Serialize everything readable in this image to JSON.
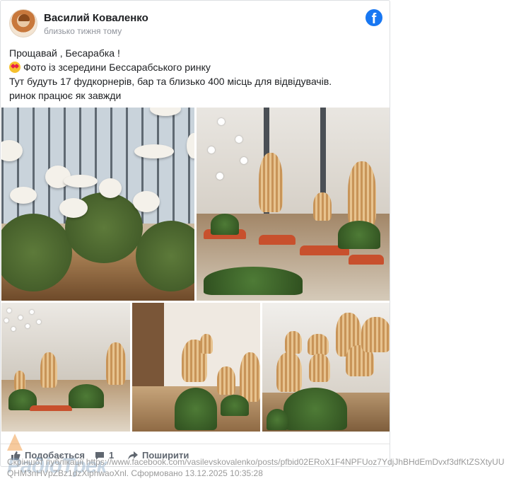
{
  "post": {
    "author": "Василий Коваленко",
    "time": "близько тижня тому",
    "text_lines": [
      "Прощавай , Бесарабка !",
      "Фото із зсередини Бессарабського ринку",
      "Тут будуть 17 фудкорнерів, бар та близько 400 місць для відвідувачів.",
      "ринок працює як завжди"
    ],
    "emoji_icon": "star-struck-emoji-icon",
    "platform_icon": "facebook-icon",
    "platform_logo_letter": "f"
  },
  "photos": [
    {
      "name": "photo-glass-roof-hall"
    },
    {
      "name": "photo-hall-with-lamps-and-sofas"
    },
    {
      "name": "photo-hall-with-bulb-chandelier"
    },
    {
      "name": "photo-food-corner-stalls"
    },
    {
      "name": "photo-wicker-pendant-lamps"
    }
  ],
  "actions": {
    "like_label": "Подобається",
    "comment_count": "1",
    "share_label": "Поширити"
  },
  "watermark": {
    "text": "РадіоТрек"
  },
  "caption": "Скріншот публікації https://www.facebook.com/vasilevskovalenko/posts/pfbid02ERoX1F4NPFUoz7YdjJhBHdEmDvxf3dfKtZSXtyUUQHM3nHVpZBz1dzXiphwaoXnl. Сформовано 13.12.2025 10:35:28",
  "colors": {
    "facebook_blue": "#1877f2",
    "text_dark": "#1c1e21",
    "text_muted": "#90949c",
    "action_gray": "#606770"
  }
}
